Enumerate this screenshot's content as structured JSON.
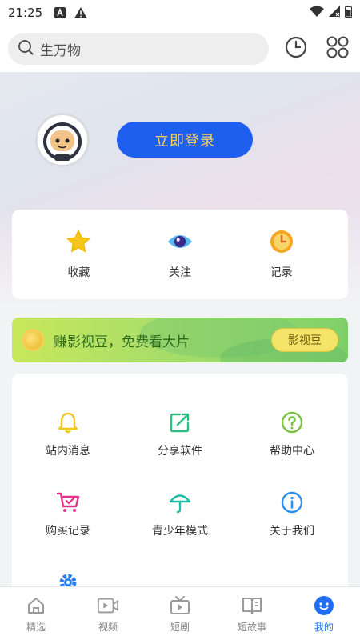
{
  "status_bar": {
    "time": "21:25"
  },
  "search": {
    "placeholder": "生万物"
  },
  "profile": {
    "login_label": "立即登录"
  },
  "quick_actions": [
    {
      "label": "收藏",
      "icon": "star-icon"
    },
    {
      "label": "关注",
      "icon": "eye-icon"
    },
    {
      "label": "记录",
      "icon": "clock-icon"
    }
  ],
  "banner": {
    "text": "赚影视豆，免费看大片",
    "button_label": "影视豆"
  },
  "services": [
    {
      "label": "站内消息",
      "icon": "bell-icon"
    },
    {
      "label": "分享软件",
      "icon": "share-icon"
    },
    {
      "label": "帮助中心",
      "icon": "help-icon"
    },
    {
      "label": "购买记录",
      "icon": "cart-icon"
    },
    {
      "label": "青少年模式",
      "icon": "umbrella-icon"
    },
    {
      "label": "关于我们",
      "icon": "info-icon"
    },
    {
      "label": "",
      "icon": "settings-icon"
    }
  ],
  "tabbar": [
    {
      "label": "精选",
      "icon": "home-icon",
      "active": false
    },
    {
      "label": "视频",
      "icon": "video-icon",
      "active": false
    },
    {
      "label": "短剧",
      "icon": "tv-icon",
      "active": false
    },
    {
      "label": "短故事",
      "icon": "book-icon",
      "active": false
    },
    {
      "label": "我的",
      "icon": "smiley-icon",
      "active": true
    }
  ],
  "colors": {
    "primary": "#1f5ff0",
    "login_text": "#f4d25a",
    "star": "#f5c518",
    "tab_active": "#1f6ef5",
    "banner_text": "#2d6a1e"
  }
}
